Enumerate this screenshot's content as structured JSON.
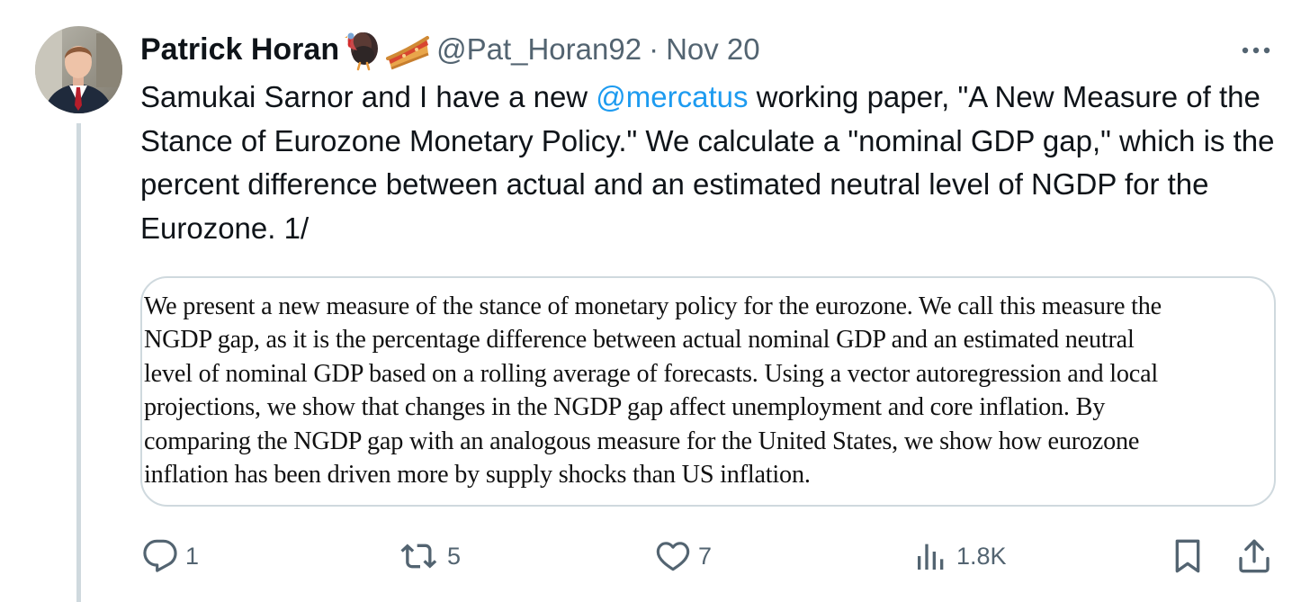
{
  "tweet": {
    "author_name": "Patrick Horan",
    "name_emojis": [
      "turkey",
      "pie"
    ],
    "handle": "@Pat_Horan92",
    "separator": "·",
    "date": "Nov 20",
    "text_before_mention": "Samukai Sarnor and I have a new ",
    "mention": "@mercatus",
    "text_after_mention": " working paper, \"A New Measure of the Stance of Eurozone Monetary Policy.\" We calculate a \"nominal GDP gap,\" which is the percent difference between actual and an estimated neutral level of NGDP for the Eurozone. 1/"
  },
  "media": {
    "lines": [
      "We present a new measure of the stance of monetary policy for the eurozone. We call this measure the",
      "NGDP gap, as it is the percentage difference between actual nominal GDP and an estimated neutral",
      "level of nominal GDP based on a rolling average of forecasts. Using a vector autoregression  and local",
      "projections, we show that changes in the NGDP gap affect unemployment and core inflation. By",
      "comparing the NGDP gap with an analogous measure for the United States, we show how eurozone",
      "inflation has been driven more by supply shocks than US inflation."
    ]
  },
  "actions": {
    "reply_count": "1",
    "retweet_count": "5",
    "like_count": "7",
    "views_count": "1.8K"
  },
  "icons": {
    "more": "more-icon",
    "reply": "reply-icon",
    "retweet": "retweet-icon",
    "like": "like-icon",
    "views": "views-icon",
    "bookmark": "bookmark-icon",
    "share": "share-icon"
  },
  "colors": {
    "text": "#0f1419",
    "secondary": "#536471",
    "link": "#1d9bf0",
    "border": "#cfd9de"
  }
}
